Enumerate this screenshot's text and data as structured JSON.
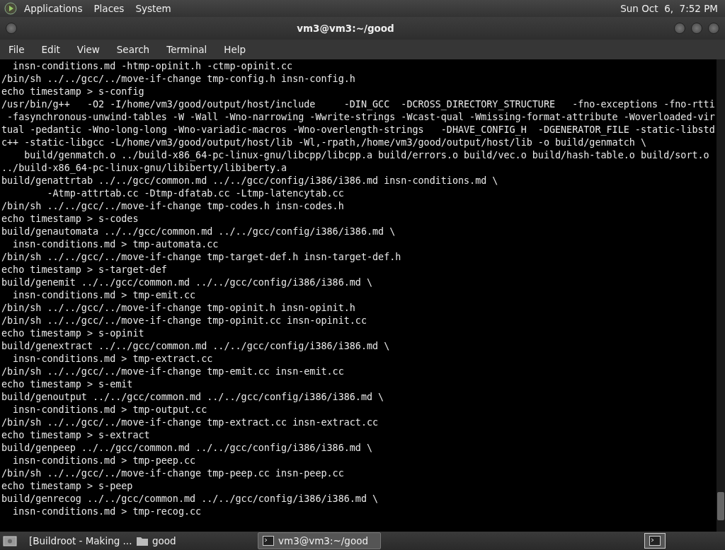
{
  "top_panel": {
    "menus": [
      "Applications",
      "Places",
      "System"
    ],
    "clock": "Sun Oct  6,  7:52 PM"
  },
  "window": {
    "title": "vm3@vm3:~/good"
  },
  "menu_bar": [
    "File",
    "Edit",
    "View",
    "Search",
    "Terminal",
    "Help"
  ],
  "terminal": {
    "lines": [
      "  insn-conditions.md -htmp-opinit.h -ctmp-opinit.cc",
      "/bin/sh ../../gcc/../move-if-change tmp-config.h insn-config.h",
      "echo timestamp > s-config",
      "/usr/bin/g++   -O2 -I/home/vm3/good/output/host/include     -DIN_GCC  -DCROSS_DIRECTORY_STRUCTURE   -fno-exceptions -fno-rtti",
      " -fasynchronous-unwind-tables -W -Wall -Wno-narrowing -Wwrite-strings -Wcast-qual -Wmissing-format-attribute -Woverloaded-vir",
      "tual -pedantic -Wno-long-long -Wno-variadic-macros -Wno-overlength-strings   -DHAVE_CONFIG_H  -DGENERATOR_FILE -static-libstd",
      "c++ -static-libgcc -L/home/vm3/good/output/host/lib -Wl,-rpath,/home/vm3/good/output/host/lib -o build/genmatch \\",
      "    build/genmatch.o ../build-x86_64-pc-linux-gnu/libcpp/libcpp.a build/errors.o build/vec.o build/hash-table.o build/sort.o",
      "../build-x86_64-pc-linux-gnu/libiberty/libiberty.a",
      "build/genattrtab ../../gcc/common.md ../../gcc/config/i386/i386.md insn-conditions.md \\",
      "        -Atmp-attrtab.cc -Dtmp-dfatab.cc -Ltmp-latencytab.cc",
      "/bin/sh ../../gcc/../move-if-change tmp-codes.h insn-codes.h",
      "echo timestamp > s-codes",
      "build/genautomata ../../gcc/common.md ../../gcc/config/i386/i386.md \\",
      "  insn-conditions.md > tmp-automata.cc",
      "/bin/sh ../../gcc/../move-if-change tmp-target-def.h insn-target-def.h",
      "echo timestamp > s-target-def",
      "build/genemit ../../gcc/common.md ../../gcc/config/i386/i386.md \\",
      "  insn-conditions.md > tmp-emit.cc",
      "/bin/sh ../../gcc/../move-if-change tmp-opinit.h insn-opinit.h",
      "/bin/sh ../../gcc/../move-if-change tmp-opinit.cc insn-opinit.cc",
      "echo timestamp > s-opinit",
      "build/genextract ../../gcc/common.md ../../gcc/config/i386/i386.md \\",
      "  insn-conditions.md > tmp-extract.cc",
      "/bin/sh ../../gcc/../move-if-change tmp-emit.cc insn-emit.cc",
      "echo timestamp > s-emit",
      "build/genoutput ../../gcc/common.md ../../gcc/config/i386/i386.md \\",
      "  insn-conditions.md > tmp-output.cc",
      "/bin/sh ../../gcc/../move-if-change tmp-extract.cc insn-extract.cc",
      "echo timestamp > s-extract",
      "build/genpeep ../../gcc/common.md ../../gcc/config/i386/i386.md \\",
      "  insn-conditions.md > tmp-peep.cc",
      "/bin/sh ../../gcc/../move-if-change tmp-peep.cc insn-peep.cc",
      "echo timestamp > s-peep",
      "build/genrecog ../../gcc/common.md ../../gcc/config/i386/i386.md \\",
      "  insn-conditions.md > tmp-recog.cc"
    ]
  },
  "taskbar": {
    "items": [
      {
        "kind": "browser",
        "label": "[Buildroot - Making ...",
        "selected": false
      },
      {
        "kind": "folder",
        "label": "good",
        "selected": false
      },
      {
        "kind": "terminal",
        "label": "vm3@vm3:~/good",
        "selected": true
      }
    ]
  }
}
